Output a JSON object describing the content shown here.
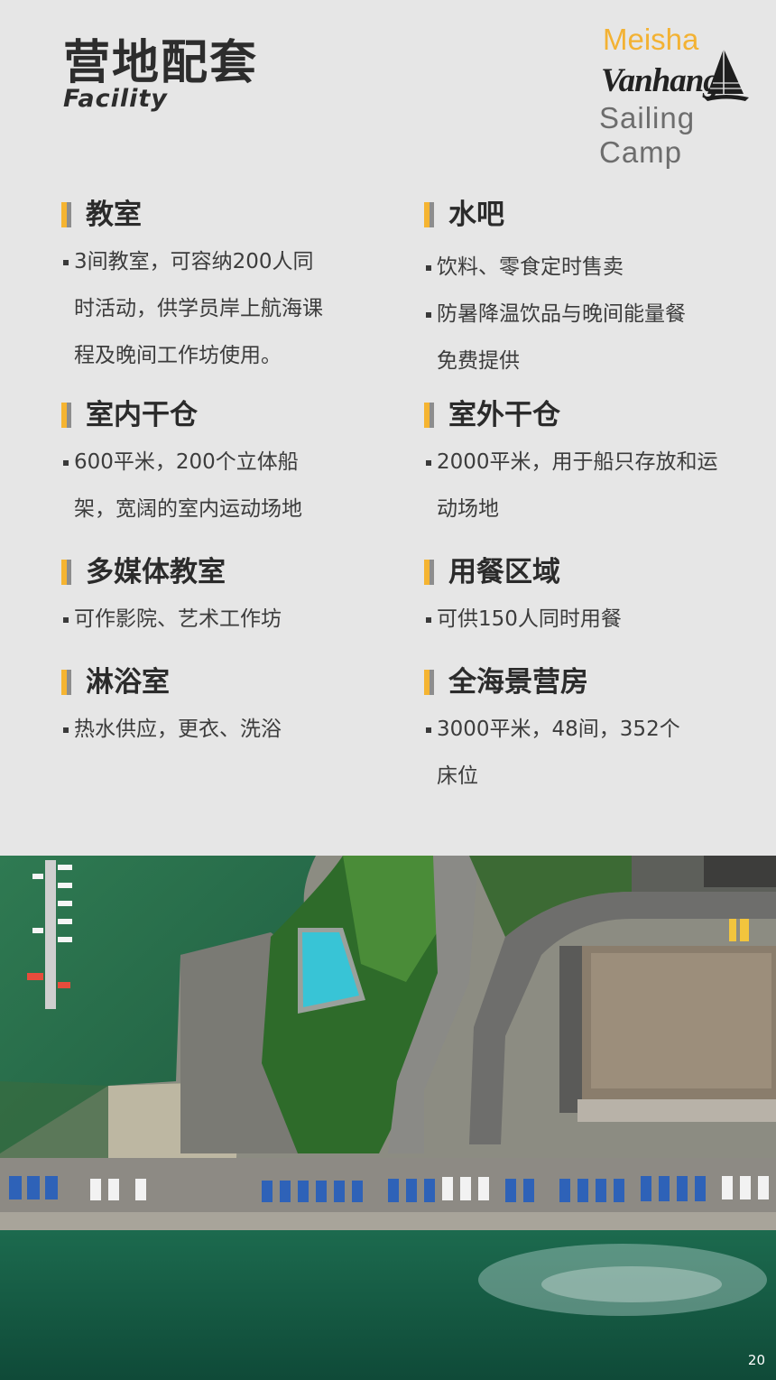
{
  "header": {
    "title_cn": "营地配套",
    "title_en": "Facility"
  },
  "logo": {
    "line1": "Meisha",
    "line2": "Vanhang",
    "line3": "Sailing",
    "line4": "Camp"
  },
  "sections": [
    {
      "title": "教室",
      "items": [
        [
          "3间教室，可容纳200人同",
          "时活动，供学员岸上航海课",
          "程及晚间工作坊使用。"
        ]
      ]
    },
    {
      "title": "水吧",
      "items": [
        [
          "饮料、零食定时售卖"
        ],
        [
          "防暑降温饮品与晚间能量餐",
          "免费提供"
        ]
      ]
    },
    {
      "title": "室内干仓",
      "items": [
        [
          "600平米，200个立体船",
          "架，宽阔的室内运动场地"
        ]
      ]
    },
    {
      "title": "室外干仓",
      "items": [
        [
          "2000平米，用于船只存放和运",
          "动场地"
        ]
      ]
    },
    {
      "title": "多媒体教室",
      "items": [
        [
          "可作影院、艺术工作坊"
        ]
      ]
    },
    {
      "title": "用餐区域",
      "items": [
        [
          "可供150人同时用餐"
        ]
      ]
    },
    {
      "title": "淋浴室",
      "items": [
        [
          "热水供应，更衣、洗浴"
        ]
      ]
    },
    {
      "title": "全海景营房",
      "items": [
        [
          "3000平米，48间，352个",
          "床位"
        ]
      ]
    }
  ],
  "colors": {
    "accent": "#f5b431",
    "accent_gray": "#8d8d8d",
    "background": "#e6e6e6"
  },
  "page_number": "20"
}
